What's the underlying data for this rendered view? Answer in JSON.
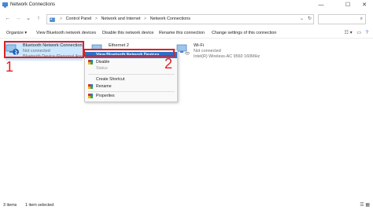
{
  "window": {
    "title": "Network Connections",
    "minimize_glyph": "—",
    "maximize_glyph": "☐",
    "close_glyph": "✕"
  },
  "navigation": {
    "back_glyph": "←",
    "forward_glyph": "→",
    "recent_glyph": "⌄",
    "up_glyph": "↑",
    "breadcrumbs": [
      "Control Panel",
      "Network and Internet",
      "Network Connections"
    ],
    "separator": ">",
    "address_dropdown_glyph": "⌄",
    "refresh_glyph": "↻",
    "search_glyph": "⌕"
  },
  "commandbar": {
    "organize": "Organize ▾",
    "view_bluetooth": "View Bluetooth network devices",
    "disable": "Disable this network device",
    "rename": "Rename this connection",
    "change_settings": "Change settings of this connection",
    "view_glyph": "☷ ▾",
    "layout_glyph": "▭",
    "help_glyph": "?"
  },
  "connections": [
    {
      "name": "Bluetooth Network Connection",
      "status": "Not connected",
      "device": "Bluetooth Device (Personal Area ..."
    },
    {
      "name": "Ethernet 2",
      "status": "",
      "device": ""
    },
    {
      "name": "Wi-Fi",
      "status": "Not connected",
      "device": "Intel(R) Wireless-AC 9560 160MHz"
    }
  ],
  "context_menu": {
    "items": [
      {
        "label": "View Bluetooth Network Devices",
        "state": "highlighted"
      },
      {
        "label": "Disable",
        "state": "normal"
      },
      {
        "label": "Status",
        "state": "disabled"
      },
      {
        "label": "Create Shortcut",
        "state": "normal"
      },
      {
        "label": "Rename",
        "state": "normal"
      },
      {
        "label": "Properties",
        "state": "normal"
      }
    ]
  },
  "annotations": {
    "step1": "1",
    "step2": "2",
    "color": "#e02020"
  },
  "statusbar": {
    "items_count": "3 items",
    "selected": "1 item selected",
    "view_glyphs": "☰ ▦"
  },
  "colors": {
    "selection": "#cce8ff",
    "menu_highlight": "#2d6fc7",
    "accent": "#0078d4"
  }
}
